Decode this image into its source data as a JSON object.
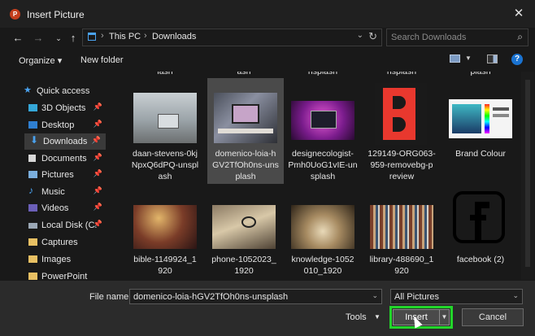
{
  "dialog": {
    "title": "Insert Picture",
    "close_icon": "close-icon",
    "app_icon_letter": "P"
  },
  "nav": {
    "back_icon": "back-arrow-icon",
    "forward_icon": "forward-arrow-icon",
    "recent_icon": "chevron-down-icon",
    "up_icon": "up-arrow-icon",
    "breadcrumb": [
      "This PC",
      "Downloads"
    ],
    "search_placeholder": "Search Downloads"
  },
  "toolbar": {
    "organize_label": "Organize ▾",
    "new_folder_label": "New folder",
    "help_label": "?"
  },
  "sidebar": {
    "items": [
      {
        "label": "Quick access",
        "icon": "star-icon",
        "pinned": false
      },
      {
        "label": "3D Objects",
        "icon": "cube-icon",
        "pinned": true
      },
      {
        "label": "Desktop",
        "icon": "desktop-icon",
        "pinned": true
      },
      {
        "label": "Downloads",
        "icon": "download-icon",
        "pinned": true,
        "selected": true
      },
      {
        "label": "Documents",
        "icon": "document-icon",
        "pinned": true
      },
      {
        "label": "Pictures",
        "icon": "picture-icon",
        "pinned": true
      },
      {
        "label": "Music",
        "icon": "music-icon",
        "pinned": true
      },
      {
        "label": "Videos",
        "icon": "video-icon",
        "pinned": true
      },
      {
        "label": "Local Disk (C:",
        "icon": "disk-icon",
        "pinned": true
      },
      {
        "label": "Captures",
        "icon": "folder-icon",
        "pinned": false
      },
      {
        "label": "Images",
        "icon": "folder-icon",
        "pinned": false
      },
      {
        "label": "PowerPoint",
        "icon": "folder-icon",
        "pinned": false
      }
    ]
  },
  "files": {
    "cut_labels": [
      "lash",
      "ash",
      "nsplash",
      "nsplash",
      "plash"
    ],
    "row1": [
      {
        "name": "daan-stevens-0kj NpxQ6dPQ-unspl ash",
        "lines": [
          "daan-stevens-0kj",
          "NpxQ6dPQ-unspl",
          "ash"
        ]
      },
      {
        "name": "domenico-loia-h GV2TfOh0ns-uns plash",
        "lines": [
          "domenico-loia-h",
          "GV2TfOh0ns-uns",
          "plash"
        ],
        "selected": true
      },
      {
        "name": "designecologist- Pmh0UoG1vIE-un splash",
        "lines": [
          "designecologist-",
          "Pmh0UoG1vIE-un",
          "splash"
        ]
      },
      {
        "name": "129149-ORG063- 959-removebg-p review",
        "lines": [
          "129149-ORG063-",
          "959-removebg-p",
          "review"
        ]
      },
      {
        "name": "Brand Colour",
        "lines": [
          "Brand Colour"
        ]
      }
    ],
    "row2": [
      {
        "name": "bible-1149924_1 920",
        "lines": [
          "bible-1149924_1",
          "920"
        ]
      },
      {
        "name": "phone-1052023_ 1920",
        "lines": [
          "phone-1052023_",
          "1920"
        ]
      },
      {
        "name": "knowledge-1052 010_1920",
        "lines": [
          "knowledge-1052",
          "010_1920"
        ]
      },
      {
        "name": "library-488690_1 920",
        "lines": [
          "library-488690_1",
          "920"
        ]
      },
      {
        "name": "facebook (2)",
        "lines": [
          "facebook (2)"
        ]
      }
    ]
  },
  "bottom": {
    "filename_label": "File name:",
    "filename_value": "domenico-loia-hGV2TfOh0ns-unsplash",
    "filter_value": "All Pictures",
    "tools_label": "Tools",
    "insert_label": "Insert",
    "cancel_label": "Cancel"
  },
  "colors": {
    "highlight": "#22d62a",
    "accent_blue": "#1a73d1"
  }
}
